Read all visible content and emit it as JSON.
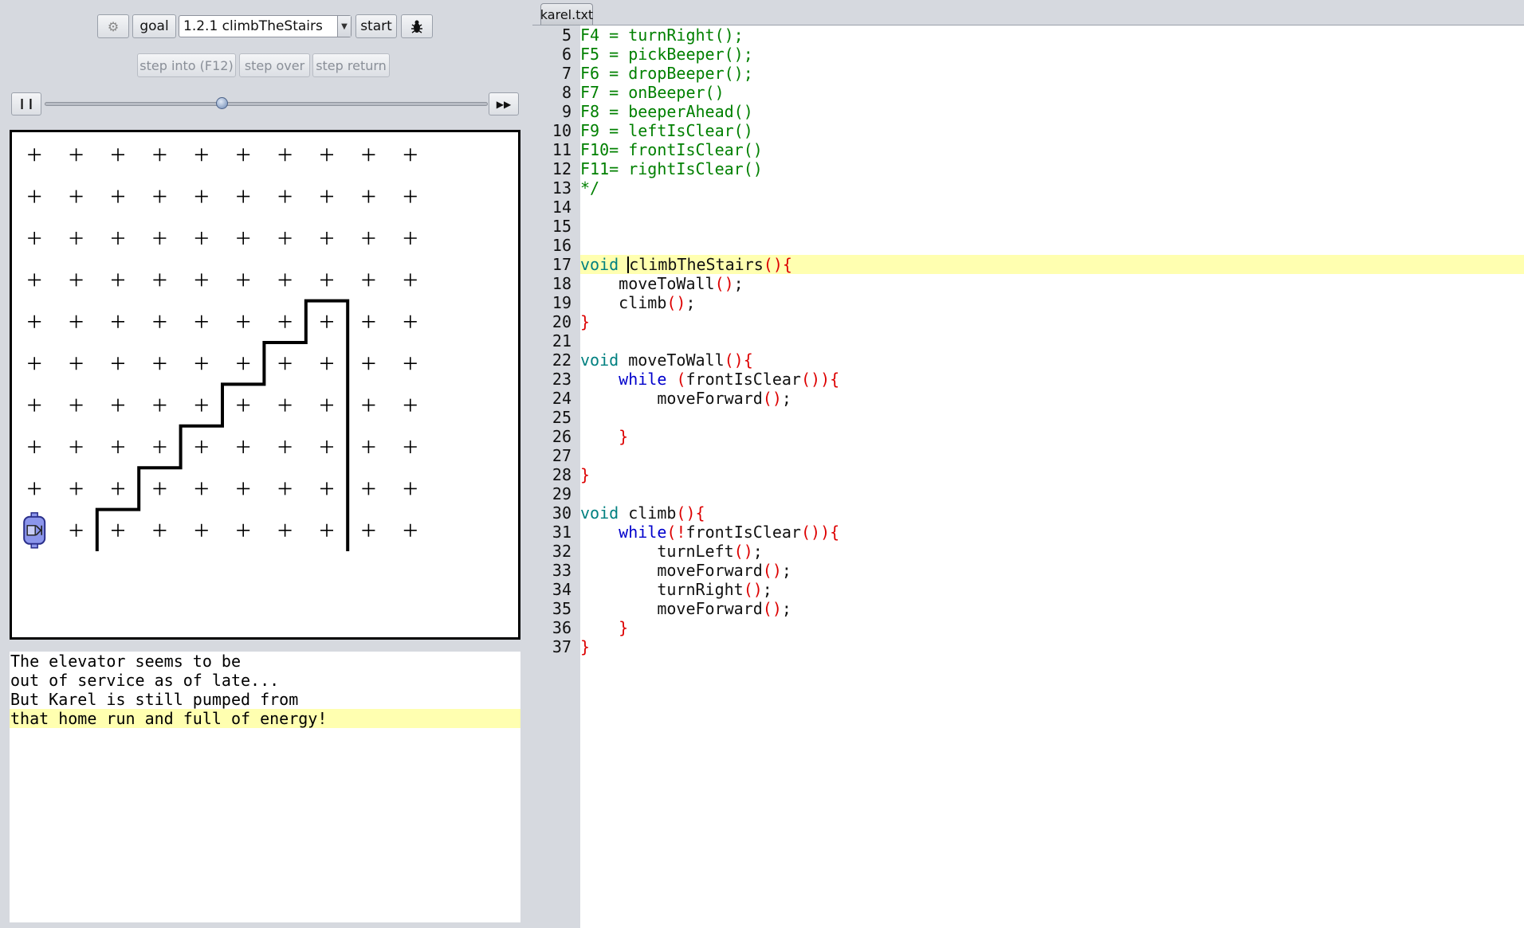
{
  "toolbar": {
    "goal_label": "goal",
    "level_selected": "1.2.1 climbTheStairs",
    "start_label": "start",
    "step_into_label": "step into (F12)",
    "step_over_label": "step over",
    "step_return_label": "step return"
  },
  "speed": {
    "value": 0.4
  },
  "world": {
    "columns": 10,
    "rows": 10,
    "karel": {
      "column": 1,
      "row": 1,
      "facing": "east"
    },
    "beepers": [],
    "stairs_wall": [
      [
        2,
        0
      ],
      [
        2,
        1
      ],
      [
        3,
        1
      ],
      [
        3,
        2
      ],
      [
        4,
        2
      ],
      [
        4,
        3
      ],
      [
        5,
        3
      ],
      [
        5,
        4
      ],
      [
        6,
        4
      ],
      [
        6,
        5
      ],
      [
        7,
        5
      ],
      [
        7,
        6
      ],
      [
        8,
        6
      ],
      [
        8,
        0
      ]
    ]
  },
  "story": {
    "lines": [
      "The elevator seems to be",
      "out of service as of late...",
      "But Karel is still pumped from",
      "that home run and full of energy!"
    ],
    "highlighted_line": 3
  },
  "editor": {
    "tab_label": "karel.txt",
    "first_line_number": 5,
    "highlighted_line": 17,
    "lines": [
      [
        [
          "F4 = turnRight();",
          "c"
        ]
      ],
      [
        [
          "F5 = pickBeeper();",
          "c"
        ]
      ],
      [
        [
          "F6 = dropBeeper();",
          "c"
        ]
      ],
      [
        [
          "F7 = onBeeper()",
          "c"
        ]
      ],
      [
        [
          "F8 = beeperAhead()",
          "c"
        ]
      ],
      [
        [
          "F9 = leftIsClear()",
          "c"
        ]
      ],
      [
        [
          "F10= frontIsClear()",
          "c"
        ]
      ],
      [
        [
          "F11= rightIsClear()",
          "c"
        ]
      ],
      [
        [
          "*/",
          "c"
        ]
      ],
      [],
      [],
      [],
      [
        [
          "void",
          "k"
        ],
        [
          " ",
          "n"
        ],
        [
          "|",
          "caret"
        ],
        [
          "climbTheStairs",
          "n"
        ],
        [
          "(){",
          "p"
        ]
      ],
      [
        [
          "    moveToWall",
          "n"
        ],
        [
          "()",
          "p"
        ],
        [
          ";",
          "n"
        ]
      ],
      [
        [
          "    climb",
          "n"
        ],
        [
          "()",
          "p"
        ],
        [
          ";",
          "n"
        ]
      ],
      [
        [
          "}",
          "p"
        ]
      ],
      [],
      [
        [
          "void",
          "k"
        ],
        [
          " moveToWall",
          "n"
        ],
        [
          "(){",
          "p"
        ]
      ],
      [
        [
          "    ",
          "n"
        ],
        [
          "while",
          "w"
        ],
        [
          " ",
          "n"
        ],
        [
          "(",
          "p"
        ],
        [
          "frontIsClear",
          "n"
        ],
        [
          "()){",
          "p"
        ]
      ],
      [
        [
          "        moveForward",
          "n"
        ],
        [
          "()",
          "p"
        ],
        [
          ";",
          "n"
        ]
      ],
      [],
      [
        [
          "    ",
          "n"
        ],
        [
          "}",
          "p"
        ]
      ],
      [],
      [
        [
          "}",
          "p"
        ]
      ],
      [],
      [
        [
          "void",
          "k"
        ],
        [
          " climb",
          "n"
        ],
        [
          "(){",
          "p"
        ]
      ],
      [
        [
          "    ",
          "n"
        ],
        [
          "while",
          "w"
        ],
        [
          "(!",
          "p"
        ],
        [
          "frontIsClear",
          "n"
        ],
        [
          "()){",
          "p"
        ]
      ],
      [
        [
          "        turnLeft",
          "n"
        ],
        [
          "()",
          "p"
        ],
        [
          ";",
          "n"
        ]
      ],
      [
        [
          "        moveForward",
          "n"
        ],
        [
          "()",
          "p"
        ],
        [
          ";",
          "n"
        ]
      ],
      [
        [
          "        turnRight",
          "n"
        ],
        [
          "()",
          "p"
        ],
        [
          ";",
          "n"
        ]
      ],
      [
        [
          "        moveForward",
          "n"
        ],
        [
          "()",
          "p"
        ],
        [
          ";",
          "n"
        ]
      ],
      [
        [
          "    ",
          "n"
        ],
        [
          "}",
          "p"
        ]
      ],
      [
        [
          "}",
          "p"
        ]
      ]
    ]
  }
}
